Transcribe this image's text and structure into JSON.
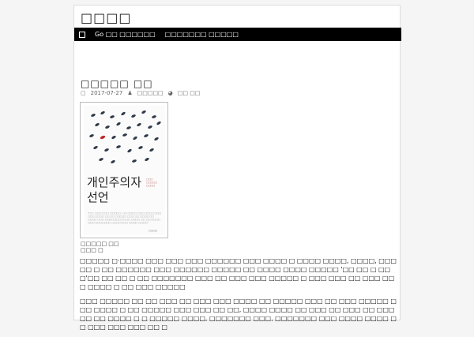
{
  "site": {
    "title": "□□□□"
  },
  "nav": {
    "items": [
      {
        "label": "Go □□ □□□□□□"
      },
      {
        "label": "□□□□□□□ □□□□□"
      }
    ]
  },
  "post": {
    "title": "□□□□□ □□",
    "date": "2017-07-27",
    "author": "□□□□□",
    "comments": "□□ □□"
  },
  "book": {
    "title_line1": "개인주의자",
    "title_line2": "선언",
    "tag": "□□□ □□□□□ □□□□",
    "quote": "\"□□: □□□ □□□ □□□□□. □□ □□□□ □□□ □□□□ □□□ □□□ □□□□ □□ □□ □□□□□ □□□ □□ □□□□ □□ □□□□ □□□ □□□□□□□ □□□□ □□□□ □□ □□ □□□□ □□□ □□□□□□□ □□□□ □□□ □□□□ □□□□\"",
    "publisher": "□□□□"
  },
  "caption": {
    "line1": "□□□□□ □□",
    "line2": "□□□ □"
  },
  "body": {
    "paragraph1": "□□□□□ □·□□□□ □□□ □□□ □□□ □□□□□□ □□□ □□□□ □ □□□□ □□□□, □□□□, □□□□□ □ □□ □□□□□□ □□□ □□□□□□ □□□□□ □□ □□□□ □□□□ □□□□□ '□□ □□ □ □□□'□□ □□ □□ □ □□ □□□□□□□ □□□ □□ □□□ □□□ □□□□□ □ □□□ □□□ □□ □□□ □□□ □□□□ □ □□ □□□ □□□□□",
    "paragraph2": "□□□ □□□□□ □□ □□ □□□ □□ □□□ □□□ □□□□ □□ □□□□□ □□□ □□ □□□ □□□□□ □□□ □□□□ □ □□ □□□□□ □□□ □□□ □□ □□, □□□□ □□□□ □□ □□□ □□ □□□ □□ □□□□□ □□ □□□□ □ □ □□□□□ □□□□, □□□□□□□ □□□, □□□□□□□ □□□ □□□□ □□□□ □□ □□□ □□□ □□□ □□ □"
  }
}
